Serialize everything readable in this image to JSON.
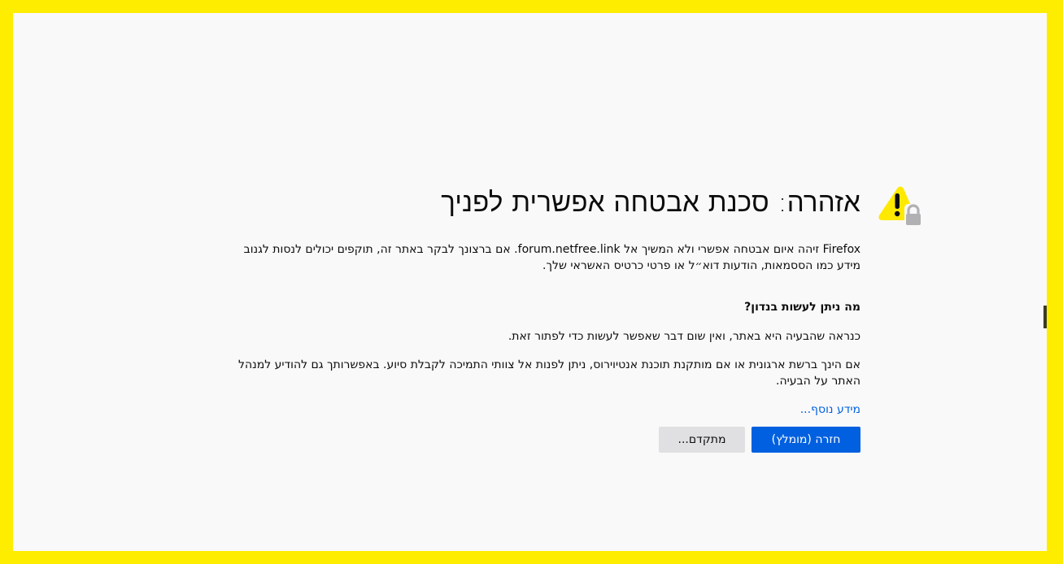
{
  "page": {
    "title": "אזהרה: סכנת אבטחה אפשרית לפניך",
    "intro": "Firefox זיהה איום אבטחה אפשרי ולא המשיך אל forum.netfree.link. אם ברצונך לבקר באתר זה, תוקפים יכולים לנסות לגנוב מידע כמו הססמאות, הודעות דוא״ל או פרטי כרטיס האשראי שלך.",
    "what_title": "מה ניתן לעשות בנדון?",
    "para1": "כנראה שהבעיה היא באתר, ואין שום דבר שאפשר לעשות כדי לפתור זאת.",
    "para2": "אם הינך ברשת ארגונית או אם מותקנת תוכנת אנטיוירוס, ניתן לפנות אל צוותי התמיכה לקבלת סיוע. באפשרותך גם להודיע למנהל האתר על הבעיה.",
    "learn_more": "מידע נוסף...",
    "back_button": "חזרה (מומלץ)",
    "advanced_button": "מתקדם..."
  },
  "icons": {
    "warning": "warning-triangle-icon",
    "lock": "lock-icon"
  },
  "colors": {
    "frame_border": "#FFED00",
    "background": "#F9F9FA",
    "primary": "#0060DF",
    "secondary": "#E0E0E2",
    "warning": "#FFE900",
    "lock": "#B1B1B3"
  }
}
